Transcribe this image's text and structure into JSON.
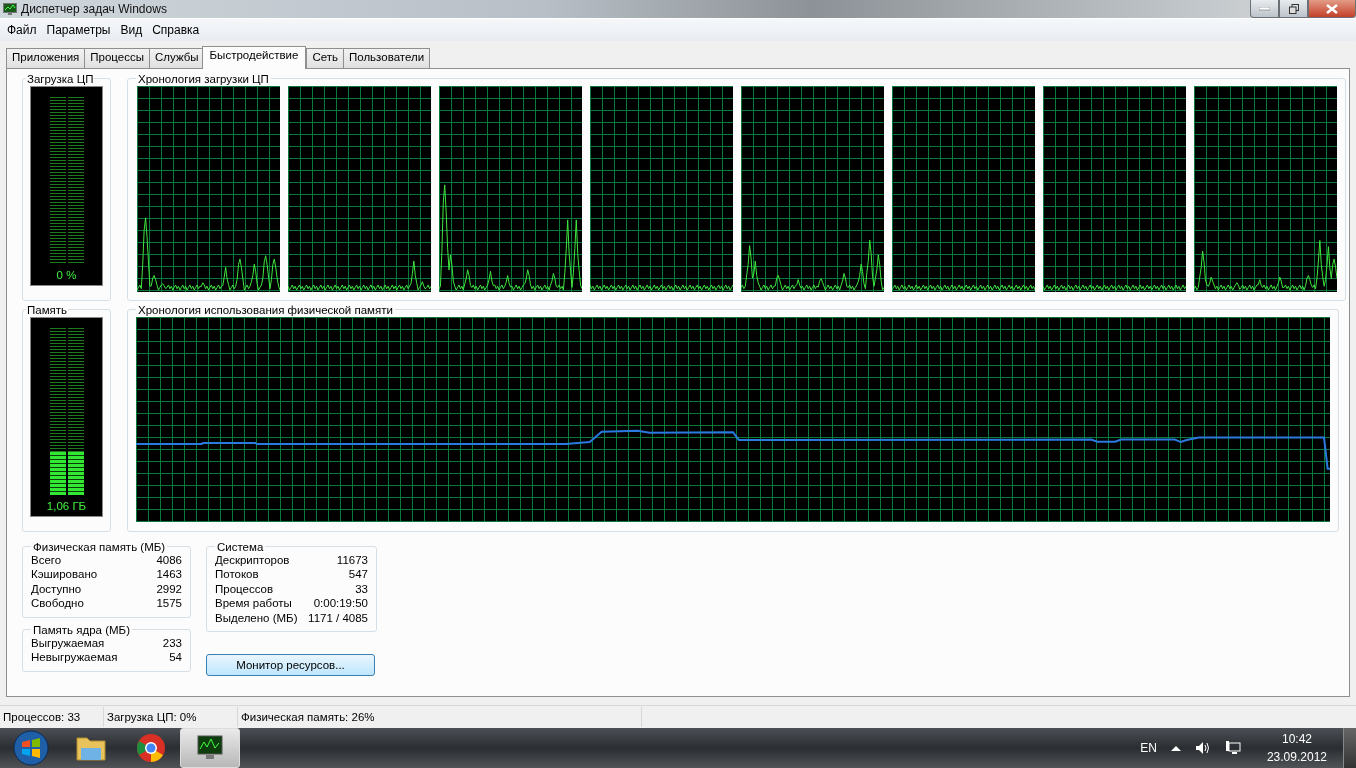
{
  "window": {
    "title": "Диспетчер задач Windows"
  },
  "menu": [
    "Файл",
    "Параметры",
    "Вид",
    "Справка"
  ],
  "tabs": [
    {
      "label": "Приложения",
      "selected": false
    },
    {
      "label": "Процессы",
      "selected": false
    },
    {
      "label": "Службы",
      "selected": false
    },
    {
      "label": "Быстродействие",
      "selected": true
    },
    {
      "label": "Сеть",
      "selected": false
    },
    {
      "label": "Пользователи",
      "selected": false
    }
  ],
  "cpu_meter": {
    "title": "Загрузка ЦП",
    "reading": "0 %"
  },
  "cpu_history": {
    "title": "Хронология загрузки ЦП"
  },
  "memory_meter": {
    "title": "Память",
    "level": 0.26,
    "reading": "1,06 ГБ"
  },
  "memory_history": {
    "title": "Хронология использования физической памяти"
  },
  "physical_memory": {
    "title": "Физическая память (МБ)",
    "rows": [
      {
        "label": "Всего",
        "value": "4086"
      },
      {
        "label": "Кэшировано",
        "value": "1463"
      },
      {
        "label": "Доступно",
        "value": "2992"
      },
      {
        "label": "Свободно",
        "value": "1575"
      }
    ]
  },
  "kernel_memory": {
    "title": "Память ядра (МБ)",
    "rows": [
      {
        "label": "Выгружаемая",
        "value": "233"
      },
      {
        "label": "Невыгружаемая",
        "value": "54"
      }
    ]
  },
  "system": {
    "title": "Система",
    "rows": [
      {
        "label": "Дескрипторов",
        "value": "11673"
      },
      {
        "label": "Потоков",
        "value": "547"
      },
      {
        "label": "Процессов",
        "value": "33"
      },
      {
        "label": "Время работы",
        "value": "0:00:19:50"
      },
      {
        "label": "Выделено (МБ)",
        "value": "1171 / 4085"
      }
    ]
  },
  "resource_monitor_button": "Монитор ресурсов...",
  "status_bar": [
    "Процессов: 33",
    "Загрузка ЦП: 0%",
    "Физическая память: 26%"
  ],
  "taskbar": {
    "language": "EN",
    "time": "10:42",
    "date": "23.09.2012"
  }
}
